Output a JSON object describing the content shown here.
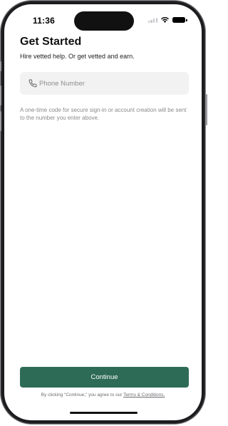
{
  "status_bar": {
    "time": "11:36"
  },
  "header": {
    "title": "Get Started",
    "subtitle": "Hire vetted help. Or get vetted and earn."
  },
  "phone_field": {
    "placeholder": "Phone Number",
    "value": "",
    "icon": "phone-icon"
  },
  "hint": {
    "text": "A one-time code for secure sign-in or account creation will be sent to the number you enter above."
  },
  "footer": {
    "continue_label": "Continue",
    "terms_prefix": "By clicking “Continue,” you agree to our ",
    "terms_link": "Terms & Conditions."
  },
  "colors": {
    "accent": "#2e6b57",
    "field_background": "#f2f2f2",
    "hint_text": "#8a8a8e"
  }
}
